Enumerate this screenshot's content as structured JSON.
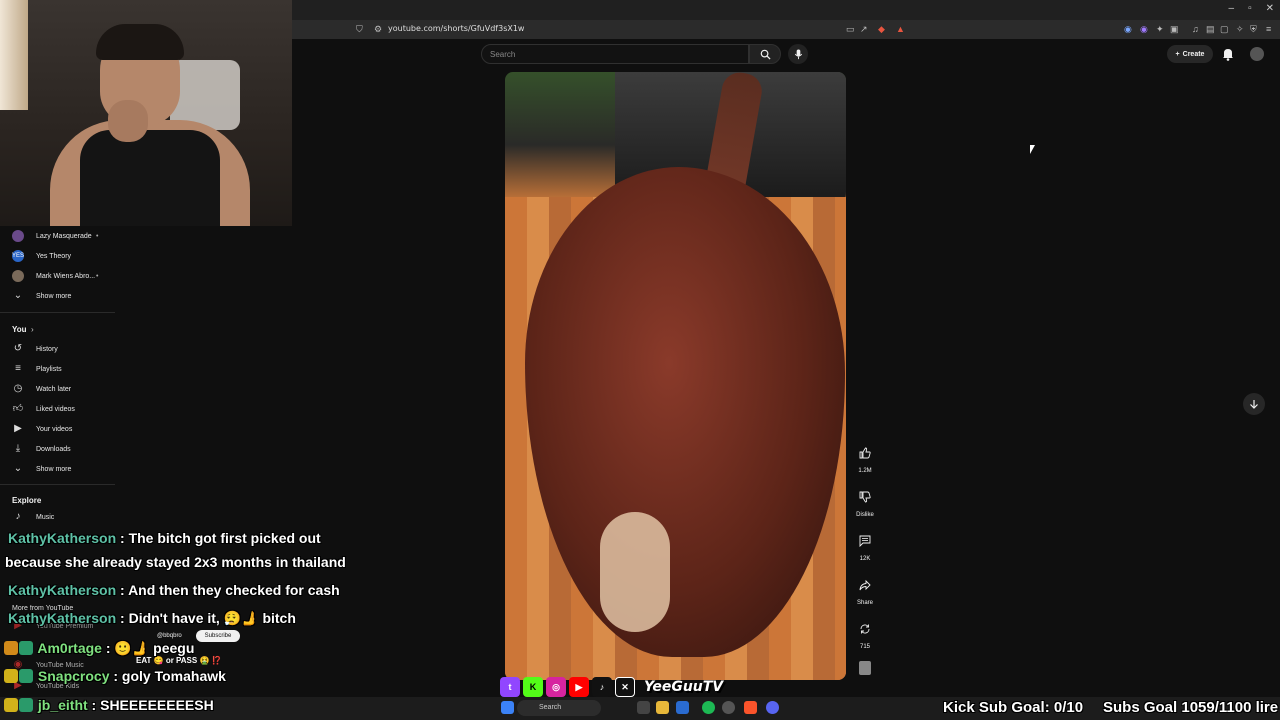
{
  "browser": {
    "url": "youtube.com/shorts/GfuVdf3sX1w"
  },
  "youtube": {
    "search_placeholder": "Search",
    "create_label": "Create"
  },
  "sidebar": {
    "subscriptions": [
      {
        "label": "Lazy Masquerade",
        "avatar_color": "#6a4a8a"
      },
      {
        "label": "Yes Theory",
        "avatar_color": "#2a66c8"
      },
      {
        "label": "Mark Wiens Abro...",
        "avatar_color": "#7a6a5a"
      }
    ],
    "show_more": "Show more",
    "you_header": "You",
    "you_items": [
      {
        "label": "History",
        "icon": "history-icon"
      },
      {
        "label": "Playlists",
        "icon": "playlists-icon"
      },
      {
        "label": "Watch later",
        "icon": "watch-later-icon"
      },
      {
        "label": "Liked videos",
        "icon": "like-icon"
      },
      {
        "label": "Your videos",
        "icon": "your-videos-icon"
      },
      {
        "label": "Downloads",
        "icon": "download-icon"
      }
    ],
    "show_more_2": "Show more",
    "explore_header": "Explore",
    "explore_items": [
      {
        "label": "Music",
        "icon": "music-icon"
      }
    ],
    "hidden_items": [
      "More from YouTube",
      "YouTube Premium",
      "YouTube Music",
      "YouTube Kids"
    ]
  },
  "short": {
    "actions": [
      {
        "label": "1.2M",
        "icon": "thumbs-up-icon"
      },
      {
        "label": "Dislike",
        "icon": "thumbs-down-icon"
      },
      {
        "label": "12K",
        "icon": "comment-icon"
      },
      {
        "label": "Share",
        "icon": "share-icon"
      },
      {
        "label": "715",
        "icon": "remix-icon"
      }
    ],
    "channel_handle": "@bbqbro",
    "subscribe_label": "Subscribe",
    "caption": "EAT 😋 or PASS 🤮 ⁉️"
  },
  "chat": [
    {
      "user": "KathyKatherson",
      "message": " : The bitch got first picked out"
    },
    {
      "user": "",
      "message": "because she already stayed 2x3 months in thailand"
    },
    {
      "user": "KathyKatherson",
      "message": " : And then they checked for cash"
    },
    {
      "user": "KathyKatherson",
      "message": " : Didn't have it, 😮‍💨🫸 bitch"
    },
    {
      "user": "Am0rtage",
      "message": " : 🙂🫸 peegu"
    },
    {
      "user": "Snapcrocy",
      "message": " : goly Tomahawk"
    },
    {
      "user": "jb_eitht",
      "message": " : SHEEEEEEEESH"
    }
  ],
  "overlay": {
    "socials": [
      "twitch",
      "kick",
      "instagram",
      "youtube",
      "tiktok",
      "x"
    ],
    "brand_name": "YeeGuuTV",
    "kick_goal": "Kick Sub Goal: 0/10",
    "subs_goal": "Subs Goal 1059/1100 lire"
  },
  "taskbar": {
    "search_label": "Search"
  }
}
